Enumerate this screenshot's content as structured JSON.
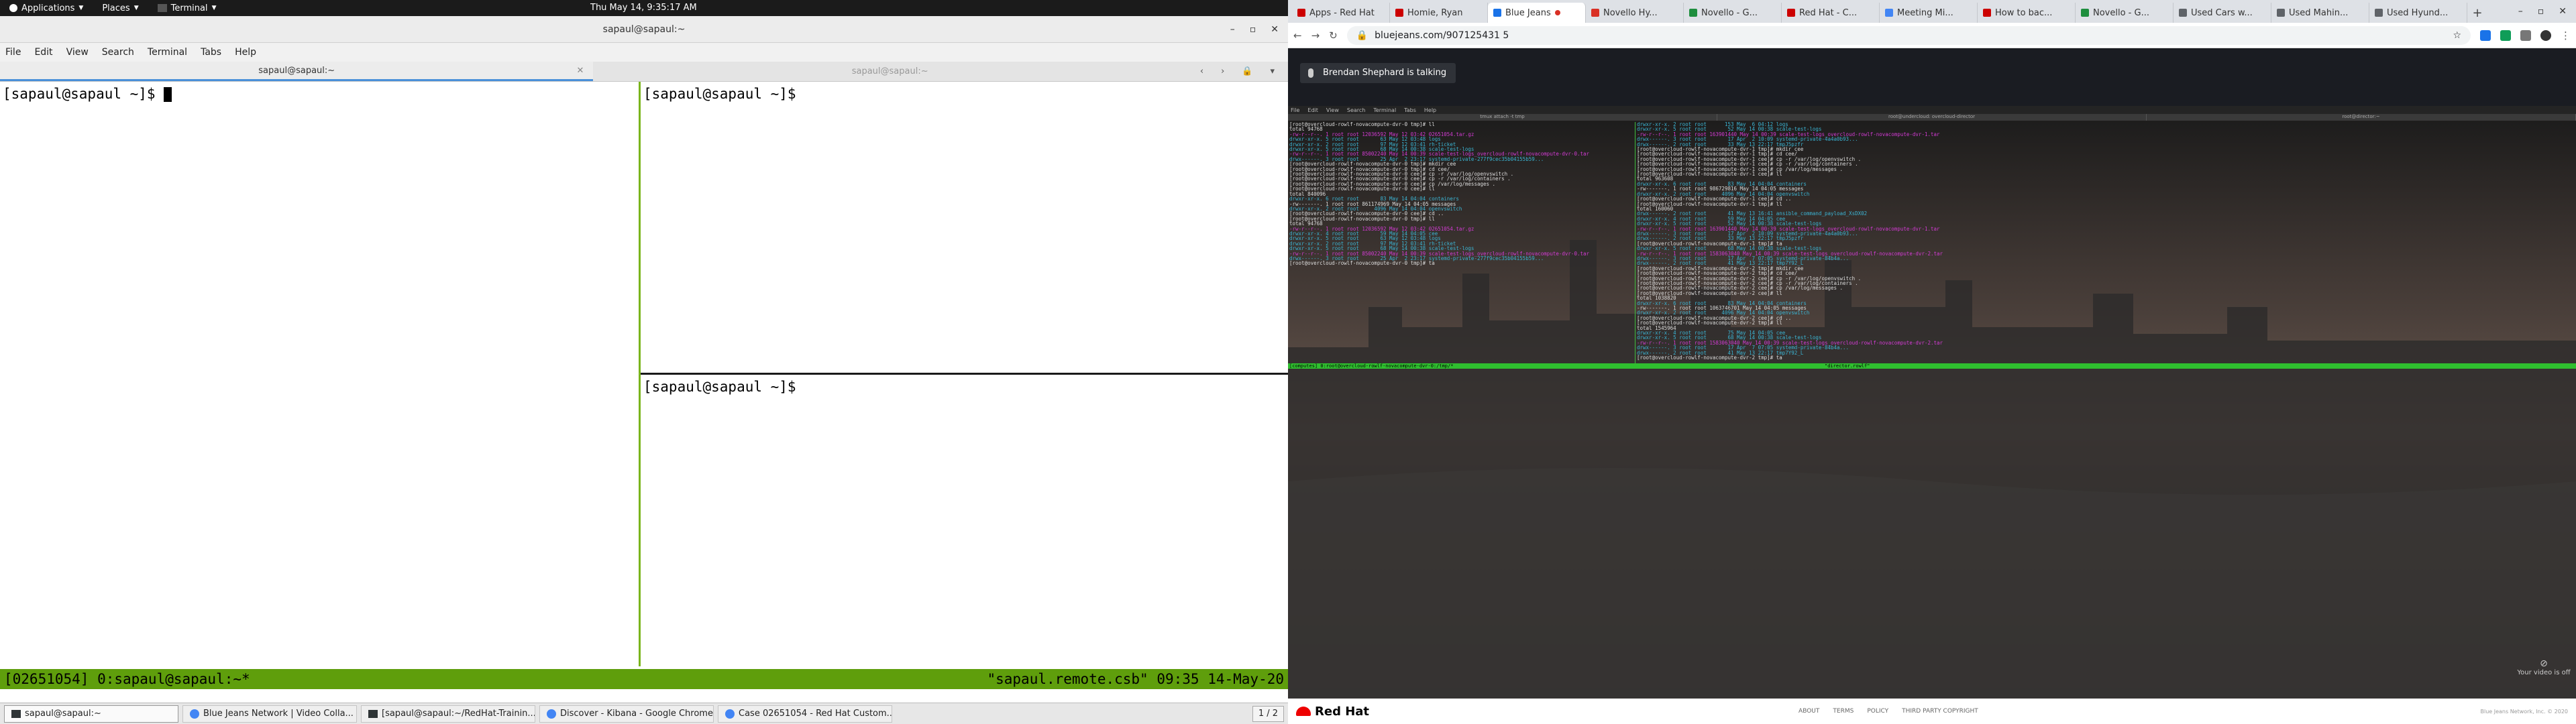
{
  "topbar": {
    "applications": "Applications",
    "places": "Places",
    "terminal": "Terminal",
    "clock": "Thu May 14,  9:35:17 AM"
  },
  "terminal_window": {
    "title": "sapaul@sapaul:~",
    "menu": [
      "File",
      "Edit",
      "View",
      "Search",
      "Terminal",
      "Tabs",
      "Help"
    ],
    "tabs": [
      "sapaul@sapaul:~",
      "sapaul@sapaul:~"
    ],
    "prompt": "[sapaul@sapaul ~]$ ",
    "status_left": "[02651054] 0:sapaul@sapaul:~*",
    "status_right": "\"sapaul.remote.csb\" 09:35 14-May-20"
  },
  "taskbar": {
    "items": [
      {
        "label": "sapaul@sapaul:~",
        "active": true,
        "icon": "terminal-icon"
      },
      {
        "label": "Blue Jeans Network | Video Colla...",
        "active": false,
        "icon": "chrome-icon"
      },
      {
        "label": "[sapaul@sapaul:~/RedHat-Trainin...",
        "active": false,
        "icon": "terminal-icon"
      },
      {
        "label": "Discover - Kibana - Google Chrome",
        "active": false,
        "icon": "chrome-icon"
      },
      {
        "label": "Case 02651054 - Red Hat Custom...",
        "active": false,
        "icon": "chrome-icon"
      }
    ],
    "pager": "1 / 2"
  },
  "browser": {
    "tabs": [
      {
        "label": "Apps - Red Hat",
        "color": "#cc0000"
      },
      {
        "label": "Homie, Ryan",
        "color": "#cc0000"
      },
      {
        "label": "Blue Jeans",
        "color": "#1a73e8",
        "active": true
      },
      {
        "label": "Novello Hy...",
        "color": "#d93025"
      },
      {
        "label": "Novello - G...",
        "color": "#1e8e3e"
      },
      {
        "label": "Red Hat - C...",
        "color": "#cc0000"
      },
      {
        "label": "Meeting Mi...",
        "color": "#4285f4"
      },
      {
        "label": "How to bac...",
        "color": "#cc0000"
      },
      {
        "label": "Novello - G...",
        "color": "#1e8e3e"
      },
      {
        "label": "Used Cars w...",
        "color": "#5f6368"
      },
      {
        "label": "Used Mahin...",
        "color": "#5f6368"
      },
      {
        "label": "Used Hyund...",
        "color": "#5f6368"
      }
    ],
    "url": "bluejeans.com/907125431 5",
    "talking": "Brendan Shephard is talking",
    "shared_menu": [
      "File",
      "Edit",
      "View",
      "Search",
      "Terminal",
      "Tabs",
      "Help"
    ],
    "shared_tabs": [
      "tmux attach -t tmp",
      "root@undercloud: overcloud-director",
      "root@director:~"
    ],
    "shared_status_left": "[computes] 0:root@overcloud-rowlf-novacompute-dvr-0:/tmp/*",
    "shared_status_right": "\"director.rowlf\"",
    "video_off": "Your video is off",
    "footer_links": [
      "ABOUT",
      "TERMS",
      "POLICY",
      "THIRD PARTY COPYRIGHT"
    ],
    "copyright": "Blue Jeans Network, Inc. © 2020",
    "redhat": "Red Hat"
  },
  "shared_left_lines": [
    "[root@overcloud-rowlf-novacompute-dvr-0 tmp]# ll",
    "total 94768",
    "-rw-r--r--. 1 root root 12036592 May 12 03:42 02651054.tar.gz",
    "drwxr-xr-x. 5 root root       63 May 12 03:48 logs",
    "drwxr-xr-x. 2 root root       97 May 12 03:41 rh-ticket",
    "drwxr-xr-x. 5 root root       68 May 14 00:38 scale-test-logs",
    "-rw-r--r--. 1 root root 85002240 May 14 00:39 scale-test-logs_overcloud-rowlf-novacompute-dvr-0.tar",
    "drwx------. 3 root root       25 Apr  2 23:17 systemd-private-277f9cec35b04155b59...",
    "[root@overcloud-rowlf-novacompute-dvr-0 tmp]# mkdir cee",
    "[root@overcloud-rowlf-novacompute-dvr-0 tmp]# cd cee/",
    "[root@overcloud-rowlf-novacompute-dvr-0 cee]# cp -r /var/log/openvswitch .",
    "[root@overcloud-rowlf-novacompute-dvr-0 cee]# cp -r /var/log/containers .",
    "[root@overcloud-rowlf-novacompute-dvr-0 cee]# cp /var/log/messages .",
    "[root@overcloud-rowlf-novacompute-dvr-0 cee]# ll",
    "total 840096",
    "drwxr-xr-x. 6 root root       83 May 14 04:04 containers",
    "-rw-------. 1 root root 861174969 May 14 04:05 messages",
    "drwxr-xr-x. 2 root root     4096 May 14 04:04 openvswitch",
    "[root@overcloud-rowlf-novacompute-dvr-0 cee]# cd ..",
    "[root@overcloud-rowlf-novacompute-dvr-0 tmp]# ll",
    "total 94768",
    "-rw-r--r--. 1 root root 12036592 May 12 03:42 02651054.tar.gz",
    "drwxr-xr-x. 4 root root       59 May 14 04:05 cee",
    "drwxr-xr-x. 5 root root       63 May 12 03:48 logs",
    "drwxr-xr-x. 2 root root       97 May 12 03:41 rh-ticket",
    "drwxr-xr-x. 5 root root       68 May 14 00:38 scale-test-logs",
    "-rw-r--r--. 1 root root 85002240 May 14 00:39 scale-test-logs_overcloud-rowlf-novacompute-dvr-0.tar",
    "drwx------. 3 root root       25 Apr  2 23:17 systemd-private-277f9cec35b04155b59...",
    "[root@overcloud-rowlf-novacompute-dvr-0 tmp]# ta"
  ],
  "shared_right_lines": [
    "drwxr-xr-x. 2 root root      153 May  6 04:12 logs",
    "drwxr-xr-x. 5 root root       52 May 14 00:38 scale-test-logs",
    "-rw-r--r--. 1 root root 163901440 May 14 00:39 scale-test-logs_overcloud-rowlf-novacompute-dvr-1.tar",
    "drwx------. 3 root root       17 Apr  2 10:09 systemd-private-4a4a0b93...",
    "drwx------. 2 root root       33 May 13 22:17 tmpJ5pzfr",
    "[root@overcloud-rowlf-novacompute-dvr-1 tmp]# mkdir cee",
    "[root@overcloud-rowlf-novacompute-dvr-1 tmp]# cd cee/",
    "[root@overcloud-rowlf-novacompute-dvr-1 cee]# cp -r /var/log/openvswitch .",
    "[root@overcloud-rowlf-novacompute-dvr-1 cee]# cp -r /var/log/containers .",
    "[root@overcloud-rowlf-novacompute-dvr-1 cee]# cp /var/log/messages .",
    "[root@overcloud-rowlf-novacompute-dvr-1 cee]# ll",
    "total 963608",
    "drwxr-xr-x. 6 root root       83 May 14 04:04 containers",
    "-rw-------. 1 root root 986729816 May 14 04:05 messages",
    "drwxr-xr-x. 2 root root     4096 May 14 04:04 openvswitch",
    "[root@overcloud-rowlf-novacompute-dvr-1 cee]# cd ..",
    "[root@overcloud-rowlf-novacompute-dvr-1 tmp]# ll",
    "total 160060",
    "drwx------. 2 root root       41 May 13 16:41 ansible_command_payload_XsDX02",
    "drwxr-xr-x. 4 root root       59 May 14 04:05 cee",
    "drwxr-xr-x. 5 root root       52 May 14 00:38 scale-test-logs",
    "-rw-r--r--. 1 root root 163901440 May 14 00:39 scale-test-logs_overcloud-rowlf-novacompute-dvr-1.tar",
    "drwx------. 3 root root       17 Apr  2 10:09 systemd-private-4a4a0b93...",
    "drwx------. 2 root root       33 May 13 22:17 tmpJ5pzfr",
    "[root@overcloud-rowlf-novacompute-dvr-1 tmp]# ta",
    "drwxr-xr-x. 5 root root       68 May 14 00:38 scale-test-logs",
    "-rw-r--r--. 1 root root 1583063040 May 14 00:39 scale-test-logs_overcloud-rowlf-novacompute-dvr-2.tar",
    "drwx------. 3 root root       17 Apr  7 07:05 systemd-private-84b4a...",
    "drwx------. 2 root root       41 May 13 22:17 tmp7Y92_L",
    "[root@overcloud-rowlf-novacompute-dvr-2 tmp]# mkdir cee",
    "[root@overcloud-rowlf-novacompute-dvr-2 tmp]# cd cee/",
    "[root@overcloud-rowlf-novacompute-dvr-2 cee]# cp -r /var/log/openvswitch .",
    "[root@overcloud-rowlf-novacompute-dvr-2 cee]# cp -r /var/log/containers .",
    "[root@overcloud-rowlf-novacompute-dvr-2 cee]# cp /var/log/messages .",
    "[root@overcloud-rowlf-novacompute-dvr-2 cee]# ll",
    "total 1038820",
    "drwxr-xr-x. 6 root root       83 May 14 04:04 containers",
    "-rw-------. 1 root root 1063746701 May 14 04:05 messages",
    "drwxr-xr-x. 2 root root     4096 May 14 04:04 openvswitch",
    "[root@overcloud-rowlf-novacompute-dvr-2 cee]# cd ..",
    "[root@overcloud-rowlf-novacompute-dvr-2 tmp]# ll",
    "total 1545964",
    "drwxr-xr-x. 4 root root       75 May 14 04:05 cee",
    "drwxr-xr-x. 5 root root       68 May 14 00:38 scale-test-logs",
    "-rw-r--r--. 1 root root 1583063040 May 14 00:39 scale-test-logs_overcloud-rowlf-novacompute-dvr-2.tar",
    "drwx------. 3 root root       17 Apr  7 07:05 systemd-private-84b4a...",
    "drwx------. 2 root root       41 May 13 22:17 tmp7Y92_L",
    "[root@overcloud-rowlf-novacompute-dvr-2 tmp]# ta"
  ]
}
